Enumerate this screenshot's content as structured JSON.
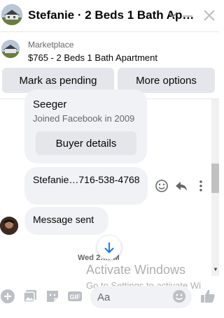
{
  "header": {
    "title": "Stefanie · 2 Beds 1 Bath Ap…"
  },
  "marketplace": {
    "label": "Marketplace",
    "listing": "$765 - 2 Beds 1 Bath Apartment"
  },
  "actions": {
    "mark_pending": "Mark as pending",
    "more_options": "More options"
  },
  "profile_card": {
    "name": "Seeger",
    "joined": "Joined Facebook in 2009",
    "buyer_details": "Buyer details"
  },
  "messages": [
    {
      "text": "Stefanie…716-538-4768"
    },
    {
      "text": "Message sent"
    }
  ],
  "timestamp": "Wed 2…PM",
  "composer": {
    "placeholder": "Aa"
  },
  "watermark": {
    "title": "Activate Windows",
    "subtitle": "Go to Settings to activate Wi"
  },
  "colors": {
    "accent": "#1877f2",
    "bubble": "#f0f2f5",
    "button": "#e4e6eb",
    "secondary_text": "#65676b",
    "icon_gray": "#bcc0c4"
  },
  "icons": [
    "house-avatar-icon",
    "chevron-down-icon",
    "minimize-icon",
    "close-icon",
    "react-icon",
    "reply-icon",
    "more-icon",
    "arrow-down-icon",
    "plus-icon",
    "photo-icon",
    "sticker-icon",
    "gif-icon",
    "emoji-icon",
    "like-icon"
  ]
}
